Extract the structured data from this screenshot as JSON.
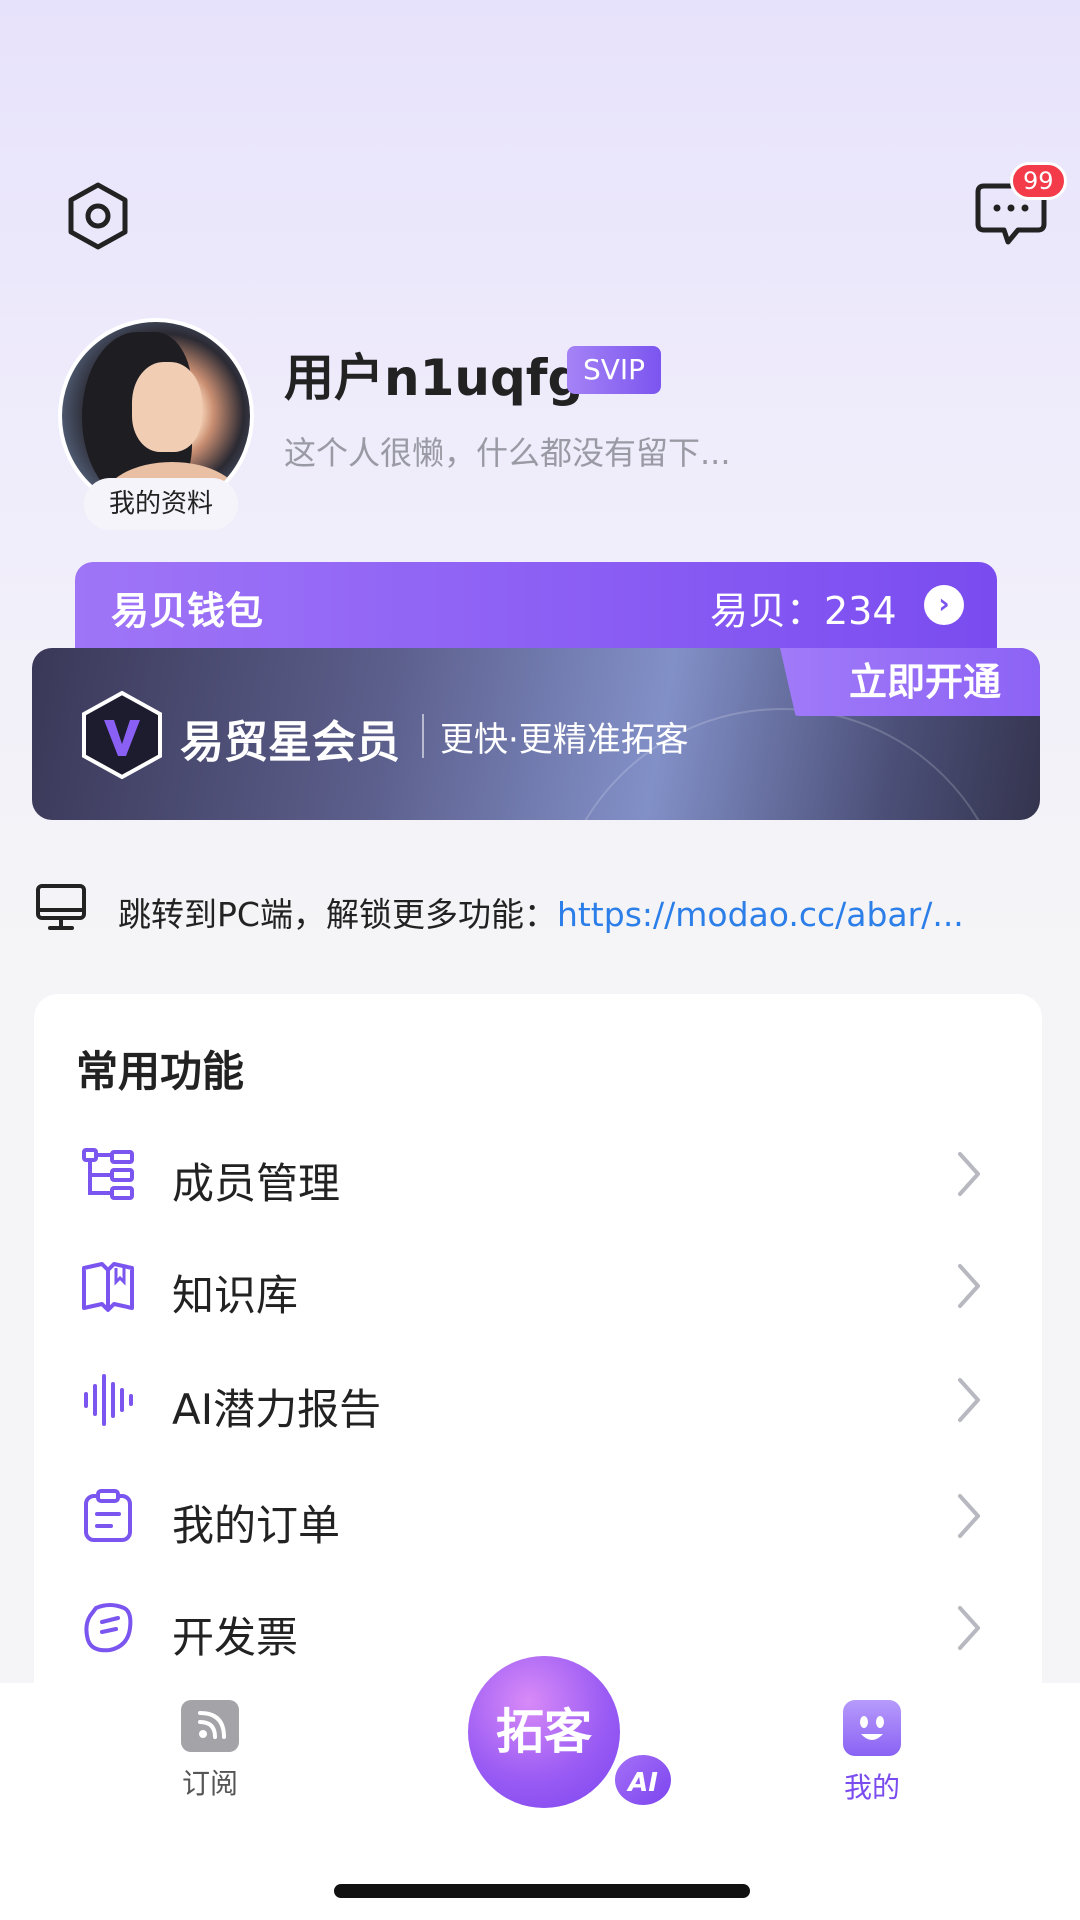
{
  "header": {
    "settings_icon": "settings-hexagon-icon",
    "message_icon": "chat-bubble-icon",
    "message_badge": "99"
  },
  "profile": {
    "username": "用户n1uqfg",
    "vip_badge": "SVIP",
    "bio": "这个人很懒，什么都没有留下...",
    "profile_tag": "我的资料"
  },
  "wallet": {
    "title": "易贝钱包",
    "amount_label": "易贝：234"
  },
  "membership": {
    "title": "易贸星会员",
    "subtitle": "更快·更精准拓客",
    "cta": "立即开通"
  },
  "pc_link": {
    "text": "跳转到PC端，解锁更多功能：",
    "url": "https://modao.cc/abar/..."
  },
  "functions": {
    "title": "常用功能",
    "items": [
      {
        "label": "成员管理",
        "icon": "org-tree-icon"
      },
      {
        "label": "知识库",
        "icon": "book-icon"
      },
      {
        "label": "AI潜力报告",
        "icon": "sound-wave-icon"
      },
      {
        "label": "我的订单",
        "icon": "clipboard-icon"
      },
      {
        "label": "开发票",
        "icon": "invoice-icon"
      }
    ]
  },
  "nav": {
    "subscribe": "订阅",
    "center": "拓客",
    "ai": "AI",
    "me": "我的"
  },
  "colors": {
    "accent": "#7b55ef",
    "link": "#2c7ee8",
    "badge": "#f33b4a"
  }
}
